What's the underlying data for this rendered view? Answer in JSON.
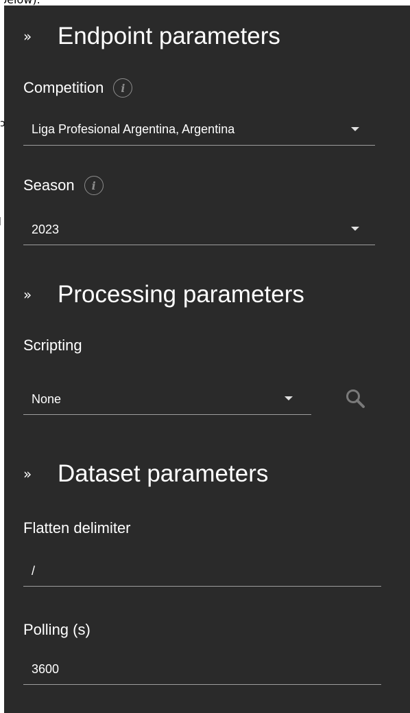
{
  "clipped_top_text": "below).",
  "sections": {
    "endpoint": {
      "title": "Endpoint parameters"
    },
    "processing": {
      "title": "Processing parameters"
    },
    "dataset": {
      "title": "Dataset parameters"
    }
  },
  "fields": {
    "competition": {
      "label": "Competition",
      "value": "Liga Profesional Argentina, Argentina"
    },
    "season": {
      "label": "Season",
      "value": "2023"
    },
    "scripting": {
      "label": "Scripting",
      "value": "None"
    },
    "flatten_delimiter": {
      "label": "Flatten delimiter",
      "value": "/"
    },
    "polling": {
      "label": "Polling (s)",
      "value": "3600"
    }
  },
  "icons": {
    "section_toggle": "double-chevron-down-icon",
    "info": "info-icon",
    "dropdown": "caret-down-icon",
    "search": "search-icon"
  },
  "colors": {
    "panel_background": "#2a2a2a",
    "text": "#ffffff",
    "underline": "#9e9e9e",
    "muted_icon": "#8d8d8d"
  }
}
